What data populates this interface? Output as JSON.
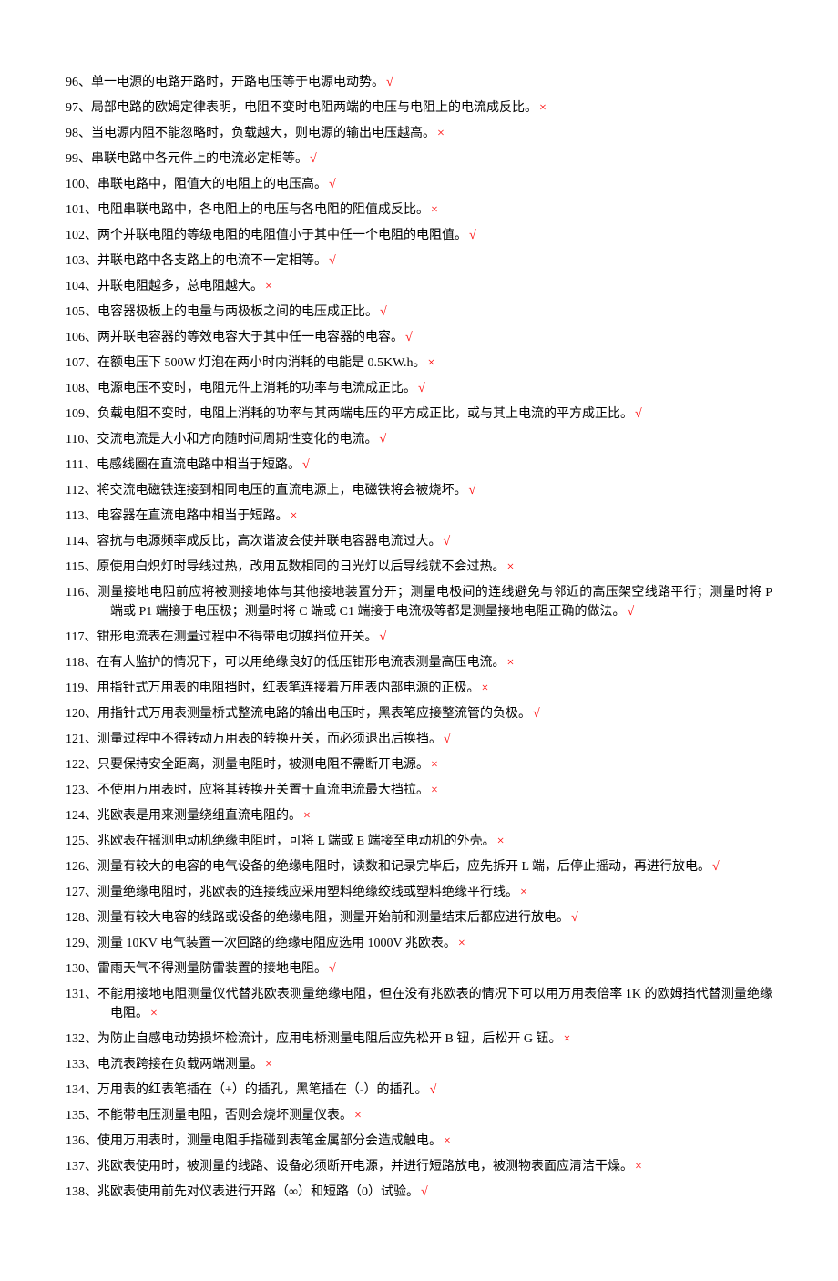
{
  "items": [
    {
      "num": "96、",
      "text": "单一电源的电路开路时，开路电压等于电源电动势。",
      "mark": "√",
      "correct": true
    },
    {
      "num": "97、",
      "text": "局部电路的欧姆定律表明，电阻不变时电阻两端的电压与电阻上的电流成反比。",
      "mark": "×",
      "correct": false
    },
    {
      "num": "98、",
      "text": "当电源内阻不能忽略时，负载越大，则电源的输出电压越高。",
      "mark": "×",
      "correct": false
    },
    {
      "num": "99、",
      "text": "串联电路中各元件上的电流必定相等。",
      "mark": "√",
      "correct": true
    },
    {
      "num": "100、",
      "text": "串联电路中，阻值大的电阻上的电压高。",
      "mark": "√",
      "correct": true
    },
    {
      "num": "101、",
      "text": "电阻串联电路中，各电阻上的电压与各电阻的阻值成反比。",
      "mark": "×",
      "correct": false
    },
    {
      "num": "102、",
      "text": "两个并联电阻的等级电阻的电阻值小于其中任一个电阻的电阻值。",
      "mark": "√",
      "correct": true
    },
    {
      "num": "103、",
      "text": "并联电路中各支路上的电流不一定相等。",
      "mark": "√",
      "correct": true
    },
    {
      "num": "104、",
      "text": "并联电阻越多，总电阻越大。",
      "mark": "×",
      "correct": false
    },
    {
      "num": "105、",
      "text": "电容器极板上的电量与两极板之间的电压成正比。",
      "mark": "√",
      "correct": true
    },
    {
      "num": "106、",
      "text": "两并联电容器的等效电容大于其中任一电容器的电容。",
      "mark": "√",
      "correct": true
    },
    {
      "num": "107、",
      "text": "在额电压下 500W 灯泡在两小时内消耗的电能是 0.5KW.h。",
      "mark": "×",
      "correct": false
    },
    {
      "num": "108、",
      "text": "电源电压不变时，电阻元件上消耗的功率与电流成正比。",
      "mark": "√",
      "correct": true
    },
    {
      "num": "109、",
      "text": "负载电阻不变时，电阻上消耗的功率与其两端电压的平方成正比，或与其上电流的平方成正比。",
      "mark": "√",
      "correct": true
    },
    {
      "num": "110、",
      "text": "交流电流是大小和方向随时间周期性变化的电流。",
      "mark": "√",
      "correct": true
    },
    {
      "num": "111、",
      "text": "电感线圈在直流电路中相当于短路。",
      "mark": "√",
      "correct": true
    },
    {
      "num": "112、",
      "text": "将交流电磁铁连接到相同电压的直流电源上，电磁铁将会被烧坏。",
      "mark": "√",
      "correct": true
    },
    {
      "num": "113、",
      "text": "电容器在直流电路中相当于短路。",
      "mark": "×",
      "correct": false
    },
    {
      "num": "114、",
      "text": "容抗与电源频率成反比，高次谐波会使并联电容器电流过大。",
      "mark": "√",
      "correct": true
    },
    {
      "num": "115、",
      "text": "原使用白炽灯时导线过热，改用瓦数相同的日光灯以后导线就不会过热。",
      "mark": "×",
      "correct": false
    },
    {
      "num": "116、",
      "text": "测量接地电阻前应将被测接地体与其他接地装置分开；测量电极间的连线避免与邻近的高压架空线路平行；测量时将 P 端或 P1 端接于电压极；测量时将 C 端或 C1 端接于电流极等都是测量接地电阻正确的做法。",
      "mark": "√",
      "correct": true
    },
    {
      "num": "117、",
      "text": "钳形电流表在测量过程中不得带电切换挡位开关。",
      "mark": "√",
      "correct": true
    },
    {
      "num": "118、",
      "text": "在有人监护的情况下，可以用绝缘良好的低压钳形电流表测量高压电流。",
      "mark": "×",
      "correct": false
    },
    {
      "num": "119、",
      "text": "用指针式万用表的电阻挡时，红表笔连接着万用表内部电源的正极。",
      "mark": "×",
      "correct": false
    },
    {
      "num": "120、",
      "text": "用指针式万用表测量桥式整流电路的输出电压时，黑表笔应接整流管的负极。",
      "mark": "√",
      "correct": true
    },
    {
      "num": "121、",
      "text": "测量过程中不得转动万用表的转换开关，而必须退出后换挡。",
      "mark": "√",
      "correct": true
    },
    {
      "num": "122、",
      "text": "只要保持安全距离，测量电阻时，被测电阻不需断开电源。",
      "mark": "×",
      "correct": false
    },
    {
      "num": "123、",
      "text": "不使用万用表时，应将其转换开关置于直流电流最大挡拉。",
      "mark": "×",
      "correct": false
    },
    {
      "num": "124、",
      "text": "兆欧表是用来测量绕组直流电阻的。",
      "mark": "×",
      "correct": false
    },
    {
      "num": "125、",
      "text": "兆欧表在摇测电动机绝缘电阻时，可将 L 端或 E 端接至电动机的外壳。",
      "mark": "×",
      "correct": false
    },
    {
      "num": "126、",
      "text": "测量有较大的电容的电气设备的绝缘电阻时，读数和记录完毕后，应先拆开 L 端，后停止摇动，再进行放电。",
      "mark": "√",
      "correct": true
    },
    {
      "num": "127、",
      "text": "测量绝缘电阻时，兆欧表的连接线应采用塑料绝缘绞线或塑料绝缘平行线。",
      "mark": "×",
      "correct": false
    },
    {
      "num": "128、",
      "text": "测量有较大电容的线路或设备的绝缘电阻，测量开始前和测量结束后都应进行放电。",
      "mark": "√",
      "correct": true
    },
    {
      "num": "129、",
      "text": "测量 10KV 电气装置一次回路的绝缘电阻应选用 1000V 兆欧表。",
      "mark": "×",
      "correct": false
    },
    {
      "num": "130、",
      "text": "雷雨天气不得测量防雷装置的接地电阻。",
      "mark": "√",
      "correct": true
    },
    {
      "num": "131、",
      "text": "不能用接地电阻测量仪代替兆欧表测量绝缘电阻，但在没有兆欧表的情况下可以用万用表倍率 1K 的欧姆挡代替测量绝缘电阻。",
      "mark": "×",
      "correct": false
    },
    {
      "num": "132、",
      "text": "为防止自感电动势损坏检流计，应用电桥测量电阻后应先松开 B 钮，后松开 G 钮。",
      "mark": "×",
      "correct": false
    },
    {
      "num": "133、",
      "text": "电流表跨接在负载两端测量。",
      "mark": "×",
      "correct": false
    },
    {
      "num": "134、",
      "text": "万用表的红表笔插在（+）的插孔，黑笔插在（-）的插孔。",
      "mark": "√",
      "correct": true
    },
    {
      "num": "135、",
      "text": "不能带电压测量电阻，否则会烧坏测量仪表。",
      "mark": "×",
      "correct": false
    },
    {
      "num": "136、",
      "text": "使用万用表时，测量电阻手指碰到表笔金属部分会造成触电。",
      "mark": "×",
      "correct": false
    },
    {
      "num": "137、",
      "text": "兆欧表使用时，被测量的线路、设备必须断开电源，并进行短路放电，被测物表面应清洁干燥。",
      "mark": "×",
      "correct": false
    },
    {
      "num": "138、",
      "text": "兆欧表使用前先对仪表进行开路（∞）和短路（0）试验。",
      "mark": "√",
      "correct": true
    }
  ]
}
